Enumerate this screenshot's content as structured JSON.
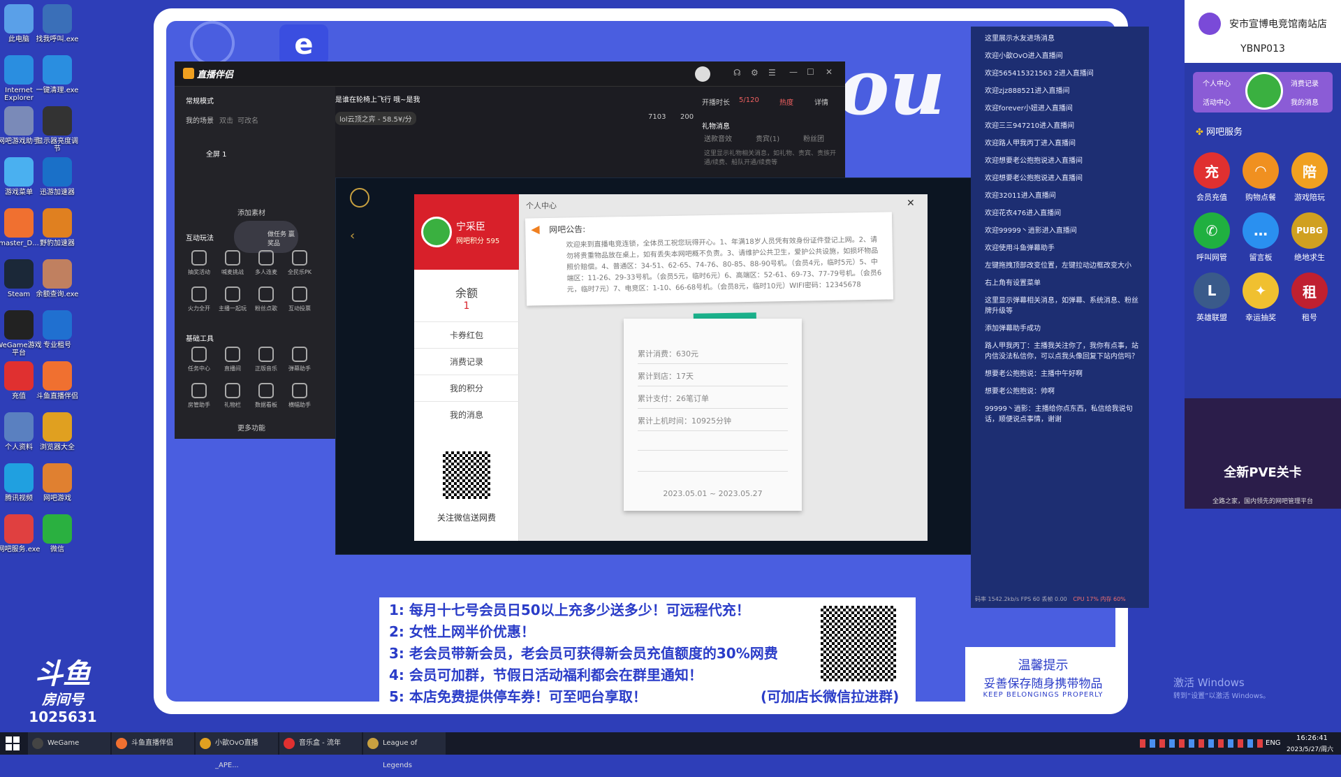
{
  "desktop": {
    "icons": [
      {
        "label": "此电脑",
        "icon": "computer-icon",
        "color": "#5aa0e8"
      },
      {
        "label": "找我呼叫.exe",
        "icon": "call-icon",
        "color": "#3a6fb8"
      },
      {
        "label": "Internet Explorer",
        "icon": "ie-icon",
        "color": "#2a8ee0"
      },
      {
        "label": "一键清理.exe",
        "icon": "clean-icon",
        "color": "#2a8ee0"
      },
      {
        "label": "网吧游戏助手",
        "icon": "game-helper-icon",
        "color": "#7a8ab8"
      },
      {
        "label": "显示器亮度调节",
        "icon": "monitor-icon",
        "color": "#333"
      },
      {
        "label": "游戏菜单",
        "icon": "cloud-icon",
        "color": "#4ab0f0"
      },
      {
        "label": "迅游加速器",
        "icon": "accelerator-icon",
        "color": "#1a70c8"
      },
      {
        "label": "master_D...",
        "icon": "douyu-icon",
        "color": "#f07030"
      },
      {
        "label": "野豹加速器",
        "icon": "leopard-icon",
        "color": "#e08020"
      },
      {
        "label": "Steam",
        "icon": "steam-icon",
        "color": "#1b2838"
      },
      {
        "label": "余额查询.exe",
        "icon": "balance-icon",
        "color": "#c08060"
      },
      {
        "label": "WeGame游戏平台",
        "icon": "wegame-icon",
        "color": "#222"
      },
      {
        "label": "专业租号",
        "icon": "rent-icon",
        "color": "#2070d0"
      },
      {
        "label": "充值",
        "icon": "recharge-icon",
        "color": "#e03030"
      },
      {
        "label": "斗鱼直播伴侣",
        "icon": "douyu-companion-icon",
        "color": "#f07030"
      },
      {
        "label": "个人资料",
        "icon": "user-icon",
        "color": "#5a80c0"
      },
      {
        "label": "浏览器大全",
        "icon": "chrome-icon",
        "color": "#e0a020"
      },
      {
        "label": "腾讯视频",
        "icon": "video-icon",
        "color": "#20a0e0"
      },
      {
        "label": "网吧游戏",
        "icon": "netcafe-game-icon",
        "color": "#e08030"
      },
      {
        "label": "网吧服务.exe",
        "icon": "service-icon",
        "color": "#e04040"
      },
      {
        "label": "微信",
        "icon": "wechat-icon",
        "color": "#2ab040"
      }
    ],
    "room_label": "房间号",
    "room_number": "1025631",
    "watermark": "激活 Windows",
    "watermark_sub": "转到“设置”以激活 Windows。"
  },
  "stream_app": {
    "title": "直播伴侣",
    "mode": "常规模式",
    "scene_label": "我的场景",
    "scene_tabs": [
      "双击",
      "可改名"
    ],
    "scene_item": "全屏 1",
    "add_source": "添加素材",
    "stream_title": "是谁在轮椅上飞行 哦~是我",
    "category": "lol云顶之弈 - 58.5¥/分",
    "stats": {
      "followers": "7103",
      "likes": "200"
    },
    "live_duration_label": "开播时长",
    "live_duration": "5/120",
    "hot_label": "热度",
    "detail_label": "详情",
    "gift_title": "礼物消息",
    "gift_tabs": [
      "送款音效",
      "贵宾(1)",
      "粉丝团"
    ],
    "gift_tip": "这里显示礼物相关消息，如礼物、贵宾、贵族开通/续费、船队开通/续费等",
    "interactive_title": "互动玩法",
    "interactive_tools": [
      "抽奖活动",
      "喊麦挑战",
      "多人连麦",
      "全民乐PK",
      "火力全开",
      "主播一起玩",
      "粉丝点歌",
      "互动投票"
    ],
    "basic_title": "基础工具",
    "basic_tools": [
      "任务中心",
      "直播间",
      "正版音乐",
      "弹幕助手",
      "房管助手",
      "礼物栏",
      "数据看板",
      "横幅助手"
    ],
    "more": "更多功能",
    "task_badge": "做任务 赢奖品"
  },
  "dialog": {
    "title": "个人中心",
    "username": "宁采臣",
    "points": "网吧积分 595",
    "balance_label": "余额",
    "balance": "1",
    "menu": [
      "卡券红包",
      "消费记录",
      "我的积分",
      "我的消息"
    ],
    "wechat_label": "关注微信送网费",
    "notice_title": "网吧公告:",
    "notice_body": "欢迎来到直播电竞连锁，全体员工祝您玩得开心。1、年满18岁人员凭有效身份证件登记上网。2、请勿将贵重物品放在桌上，如有丢失本网吧概不负责。3、请维护公共卫生，爱护公共设施，如损坏物品照价赔偿。4、普通区：34-51、62-65、74-76、80-85、88-90号机。（会员4元，临时5元）5、中端区：11-26、29-33号机。（会员5元，临时6元）6、高端区：52-61、69-73、77-79号机。（会员6元，临时7元）7、电竞区：1-10、66-68号机。（会员8元，临时10元）WIFI密码：12345678",
    "stats": [
      "累计消费：630元",
      "累计到店：17天",
      "累计支付：26笔订单",
      "累计上机时间：10925分钟"
    ],
    "date_range": "2023.05.01 ~ 2023.05.27"
  },
  "chat": {
    "messages": [
      "这里展示水友进场消息",
      "欢迎小歆OvO进入直播间",
      "欢迎565415321563 2进入直播间",
      "欢迎zjz888521进入直播间",
      "欢迎forever小妞进入直播间",
      "欢迎三三947210进入直播间",
      "欢迎路人甲我丙丁进入直播间",
      "欢迎想要老公抱抱说进入直播间",
      "欢迎想要老公抱抱说进入直播间",
      "欢迎32011进入直播间",
      "欢迎花衣476进入直播间",
      "欢迎99999丶逍影进入直播间",
      "欢迎使用斗鱼弹幕助手",
      "左键拖拽顶部改变位置，左键拉动边框改变大小",
      "右上角有设置菜单",
      "这里显示弹幕相关消息，如弹幕、系统消息、粉丝牌升级等",
      "添加弹幕助手成功",
      "路人甲我丙丁：主播我关注你了，我你有点事，站内信没法私信你，可以点我头像回复下站内信吗？",
      "想要老公抱抱说：主播中午好啊",
      "想要老公抱抱说：帅啊",
      "99999丶逍影：主播给你点东西，私信给我说句话，顺便说点事情，谢谢"
    ],
    "status": "码率 1542.2kb/s FPS 60 丢帧 0.00",
    "cpu": "CPU 17% 内存 60%"
  },
  "sidebar": {
    "cafe_name": "安市宣博电竞馆南站店",
    "machine_id": "YBNP013",
    "card_buttons": [
      "个人中心",
      "消费记录",
      "活动中心",
      "我的消息"
    ],
    "service_title": "网吧服务",
    "services": [
      {
        "label": "会员充值",
        "icon": "recharge-icon",
        "color": "#e03030",
        "glyph": "充"
      },
      {
        "label": "购物点餐",
        "icon": "shopping-icon",
        "color": "#f09020",
        "glyph": "◠"
      },
      {
        "label": "游戏陪玩",
        "icon": "companion-icon",
        "color": "#f0a020",
        "glyph": "陪"
      },
      {
        "label": "呼叫网管",
        "icon": "phone-icon",
        "color": "#20b040",
        "glyph": "✆"
      },
      {
        "label": "留言板",
        "icon": "message-icon",
        "color": "#2a90f0",
        "glyph": "…"
      },
      {
        "label": "绝地求生",
        "icon": "pubg-icon",
        "color": "#d0a020",
        "glyph": "PUBG"
      },
      {
        "label": "英雄联盟",
        "icon": "lol-icon",
        "color": "#3a5a8a",
        "glyph": "L"
      },
      {
        "label": "幸运抽奖",
        "icon": "lottery-icon",
        "color": "#f0c030",
        "glyph": "✦"
      },
      {
        "label": "租号",
        "icon": "rent-icon",
        "color": "#c02030",
        "glyph": "租"
      }
    ],
    "promo_text": "全新PVE关卡",
    "promo_footer": "全路之家，国内领先的网吧管理平台"
  },
  "info": {
    "lines": [
      "1: 每月十七号会员日50以上充多少送多少！可远程代充！",
      "2: 女性上网半价优惠！",
      "3: 老会员带新会员，老会员可获得新会员充值额度的30%网费",
      "4: 会员可加群，节假日活动福利都会在群里通知！",
      "5: 本店免费提供停车券！可至吧台享取！"
    ],
    "wechat_note": "(可加店长微信拉进群)",
    "warm_title": "温馨提示",
    "warm_body": "妥善保存随身携带物品",
    "warm_en": "KEEP BELONGINGS PROPERLY"
  },
  "taskbar": {
    "items": [
      {
        "label": "WeGame",
        "color": "#444"
      },
      {
        "label": "斗鱼直播伴侣",
        "color": "#f07030"
      },
      {
        "label": "小歆OvO直播_APE...",
        "color": "#e0a020"
      },
      {
        "label": "音乐盒 - 流年",
        "color": "#e03030"
      },
      {
        "label": "League of Legends",
        "color": "#c8a040"
      }
    ],
    "lang": "ENG",
    "time": "16:26:41",
    "date": "2023/5/27/周六"
  }
}
